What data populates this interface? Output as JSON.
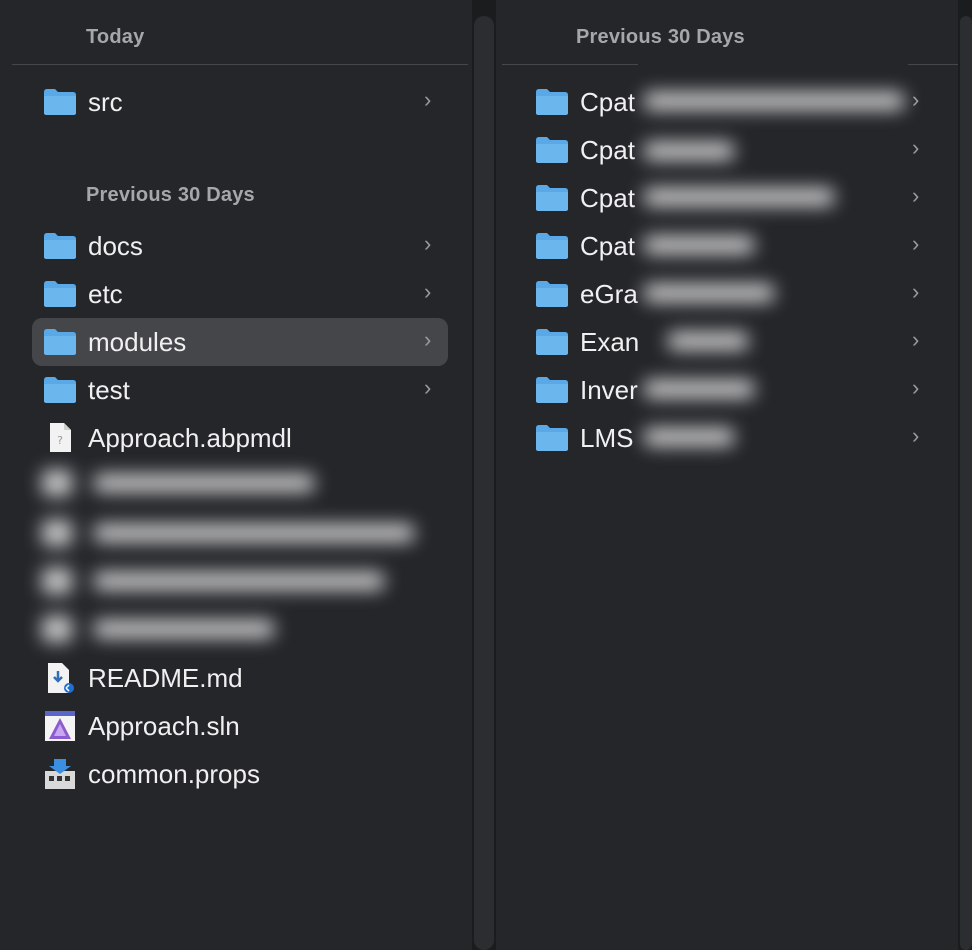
{
  "left_column": {
    "today_header": "Today",
    "today_items": [
      {
        "label": "src",
        "icon": "folder-icon",
        "has_children": true
      }
    ],
    "previous_header": "Previous 30 Days",
    "previous_items": [
      {
        "label": "docs",
        "icon": "folder-icon",
        "has_children": true
      },
      {
        "label": "etc",
        "icon": "folder-icon",
        "has_children": true
      },
      {
        "label": "modules",
        "icon": "folder-icon",
        "has_children": true,
        "selected": true
      },
      {
        "label": "test",
        "icon": "folder-icon",
        "has_children": true
      },
      {
        "label": "Approach.abpmdl",
        "icon": "generic-file-icon",
        "has_children": false
      },
      {
        "label": "README.md",
        "icon": "markdown-file-icon",
        "has_children": false
      },
      {
        "label": "Approach.sln",
        "icon": "visual-studio-solution-icon",
        "has_children": false
      },
      {
        "label": "common.props",
        "icon": "msbuild-props-icon",
        "has_children": false
      }
    ]
  },
  "right_column": {
    "previous_header": "Previous 30 Days",
    "items": [
      {
        "label": "Cpat",
        "icon": "folder-icon",
        "has_children": true
      },
      {
        "label": "Cpat",
        "icon": "folder-icon",
        "has_children": true
      },
      {
        "label": "Cpat",
        "icon": "folder-icon",
        "has_children": true
      },
      {
        "label": "Cpat",
        "icon": "folder-icon",
        "has_children": true
      },
      {
        "label": "eGra",
        "icon": "folder-icon",
        "has_children": true
      },
      {
        "label": "Exan",
        "icon": "folder-icon",
        "has_children": true
      },
      {
        "label": "Inver",
        "icon": "folder-icon",
        "has_children": true
      },
      {
        "label": "LMS",
        "icon": "folder-icon",
        "has_children": true
      }
    ]
  },
  "chevron_glyph": "›",
  "colors": {
    "folder": "#5aa8e6",
    "selected_row": "#45464a",
    "header_text": "#a6a7ab"
  }
}
